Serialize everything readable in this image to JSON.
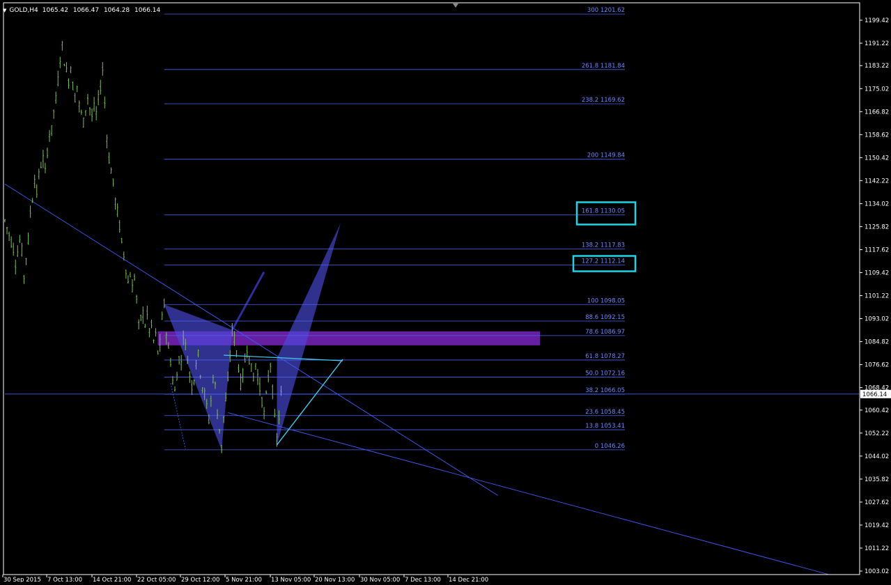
{
  "header": {
    "symbol": "GOLD,H4",
    "open": "1065.42",
    "high": "1066.47",
    "low": "1064.28",
    "close": "1066.14"
  },
  "colors": {
    "background": "#000000",
    "candles": "#7cc24a",
    "axis": "#ffffff",
    "fib_lines": "#4a63f0",
    "fib_text": "#6f86ff",
    "trend_lines": "#3f5bf5",
    "harmonic_fill": "#4a4adc",
    "zone": "#8a2ad8",
    "highlight_box": "#1ad6e8",
    "cyan_lines": "#3fd0f0"
  },
  "chart_data": {
    "type": "candlestick",
    "y_axis": {
      "range": [
        1003.02,
        1205.0
      ],
      "ticks": [
        "1199.42",
        "1191.22",
        "1183.22",
        "1175.02",
        "1166.82",
        "1158.62",
        "1150.42",
        "1142.22",
        "1134.02",
        "1125.82",
        "1117.62",
        "1109.42",
        "1101.22",
        "1093.02",
        "1084.82",
        "1076.62",
        "1068.42",
        "1060.42",
        "1052.22",
        "1044.02",
        "1035.82",
        "1027.62",
        "1019.42",
        "1011.22",
        "1003.02"
      ],
      "current_price": "1066.14"
    },
    "x_axis": {
      "labels": [
        "30 Sep 2015",
        "7 Oct 13:00",
        "14 Oct 21:00",
        "22 Oct 05:00",
        "29 Oct 12:00",
        "5 Nov 21:00",
        "13 Nov 05:00",
        "20 Nov 13:00",
        "30 Nov 05:00",
        "7 Dec 13:00",
        "14 Dec 21:00"
      ]
    },
    "price_path": [
      [
        0,
        1128
      ],
      [
        2,
        1123
      ],
      [
        4,
        1118
      ],
      [
        5,
        1113
      ],
      [
        7,
        1121
      ],
      [
        8,
        1117
      ],
      [
        9,
        1108
      ],
      [
        10,
        1115
      ],
      [
        11,
        1121
      ],
      [
        12,
        1131
      ],
      [
        13,
        1136
      ],
      [
        14,
        1143
      ],
      [
        15,
        1138
      ],
      [
        16,
        1144
      ],
      [
        17,
        1148
      ],
      [
        18,
        1150
      ],
      [
        19,
        1145
      ],
      [
        20,
        1153
      ],
      [
        21,
        1159
      ],
      [
        22,
        1160
      ],
      [
        23,
        1167
      ],
      [
        24,
        1171
      ],
      [
        25,
        1178
      ],
      [
        26,
        1186
      ],
      [
        27,
        1190
      ],
      [
        28,
        1185
      ],
      [
        29,
        1181
      ],
      [
        30,
        1178
      ],
      [
        31,
        1183
      ],
      [
        32,
        1176
      ],
      [
        33,
        1172
      ],
      [
        34,
        1176
      ],
      [
        35,
        1169
      ],
      [
        36,
        1166
      ],
      [
        37,
        1163
      ],
      [
        38,
        1168
      ],
      [
        39,
        1172
      ],
      [
        40,
        1168
      ],
      [
        41,
        1165
      ],
      [
        42,
        1168
      ],
      [
        43,
        1166
      ],
      [
        44,
        1171
      ],
      [
        45,
        1176
      ],
      [
        46,
        1182
      ],
      [
        47,
        1170
      ],
      [
        48,
        1158
      ],
      [
        49,
        1150
      ],
      [
        50,
        1146
      ],
      [
        51,
        1141
      ],
      [
        52,
        1135
      ],
      [
        53,
        1131
      ],
      [
        54,
        1126
      ],
      [
        55,
        1120
      ],
      [
        56,
        1116
      ],
      [
        57,
        1111
      ],
      [
        58,
        1106
      ],
      [
        59,
        1109
      ],
      [
        60,
        1104
      ],
      [
        61,
        1108
      ],
      [
        62,
        1100
      ],
      [
        63,
        1090
      ],
      [
        64,
        1093
      ],
      [
        65,
        1095
      ],
      [
        66,
        1091
      ],
      [
        67,
        1094
      ],
      [
        68,
        1089
      ],
      [
        69,
        1090
      ],
      [
        70,
        1085
      ],
      [
        71,
        1087
      ],
      [
        72,
        1081
      ],
      [
        73,
        1084
      ],
      [
        74,
        1093
      ],
      [
        75,
        1098
      ],
      [
        76,
        1088
      ],
      [
        77,
        1082
      ],
      [
        78,
        1078
      ],
      [
        79,
        1071
      ],
      [
        80,
        1067
      ],
      [
        81,
        1073
      ],
      [
        82,
        1079
      ],
      [
        83,
        1077
      ],
      [
        84,
        1088
      ],
      [
        85,
        1083
      ],
      [
        86,
        1079
      ],
      [
        87,
        1073
      ],
      [
        88,
        1069
      ],
      [
        89,
        1072
      ],
      [
        90,
        1078
      ],
      [
        91,
        1080
      ],
      [
        92,
        1074
      ],
      [
        93,
        1069
      ],
      [
        94,
        1066
      ],
      [
        95,
        1062
      ],
      [
        96,
        1057
      ],
      [
        97,
        1064
      ],
      [
        98,
        1072
      ],
      [
        99,
        1069
      ],
      [
        100,
        1059
      ],
      [
        101,
        1054
      ],
      [
        102,
        1047
      ],
      [
        103,
        1058
      ],
      [
        104,
        1064
      ],
      [
        105,
        1070
      ],
      [
        106,
        1080
      ],
      [
        107,
        1089
      ],
      [
        108,
        1086
      ],
      [
        109,
        1081
      ],
      [
        110,
        1076
      ],
      [
        111,
        1070
      ],
      [
        112,
        1073
      ],
      [
        113,
        1078
      ],
      [
        114,
        1083
      ],
      [
        115,
        1079
      ],
      [
        116,
        1075
      ],
      [
        117,
        1072
      ],
      [
        118,
        1077
      ],
      [
        119,
        1073
      ],
      [
        120,
        1068
      ],
      [
        121,
        1064
      ],
      [
        122,
        1059
      ],
      [
        123,
        1065
      ],
      [
        124,
        1072
      ],
      [
        125,
        1077
      ],
      [
        126,
        1067
      ],
      [
        127,
        1057
      ],
      [
        128,
        1050
      ],
      [
        129,
        1058
      ],
      [
        130,
        1066
      ],
      [
        131,
        1070
      ]
    ],
    "fibonacci_levels": [
      {
        "label": "300",
        "value": "1201.62"
      },
      {
        "label": "261.8",
        "value": "1181.84"
      },
      {
        "label": "238.2",
        "value": "1169.62"
      },
      {
        "label": "200",
        "value": "1149.84"
      },
      {
        "label": "161.8",
        "value": "1130.05"
      },
      {
        "label": "138.2",
        "value": "1117.83"
      },
      {
        "label": "127.2",
        "value": "1112.14"
      },
      {
        "label": "100",
        "value": "1098.05"
      },
      {
        "label": "88.6",
        "value": "1092.15"
      },
      {
        "label": "78.6",
        "value": "1086.97"
      },
      {
        "label": "61.8",
        "value": "1078.27"
      },
      {
        "label": "50.0",
        "value": "1072.16"
      },
      {
        "label": "38.2",
        "value": "1066.05"
      },
      {
        "label": "23.6",
        "value": "1058.45"
      },
      {
        "label": "13.8",
        "value": "1053.41"
      },
      {
        "label": "0",
        "value": "1046.26"
      }
    ],
    "highlighted_levels": [
      "161.8",
      "127.2"
    ],
    "harmonic_points": {
      "X": [
        75,
        1098.05
      ],
      "A": [
        102,
        1046.26
      ],
      "B": [
        107,
        1089
      ],
      "C": [
        128,
        1048
      ],
      "D": [
        132,
        1079
      ]
    },
    "harmonic_target": [
      158,
      1127
    ],
    "zone_range": [
      1083.5,
      1088.5
    ],
    "trend_lines": [
      {
        "from": [
          0,
          1141
        ],
        "to": [
          232,
          1030
        ]
      },
      {
        "from": [
          0,
          1066.14
        ],
        "to": [
          232,
          1066.14
        ]
      }
    ]
  }
}
